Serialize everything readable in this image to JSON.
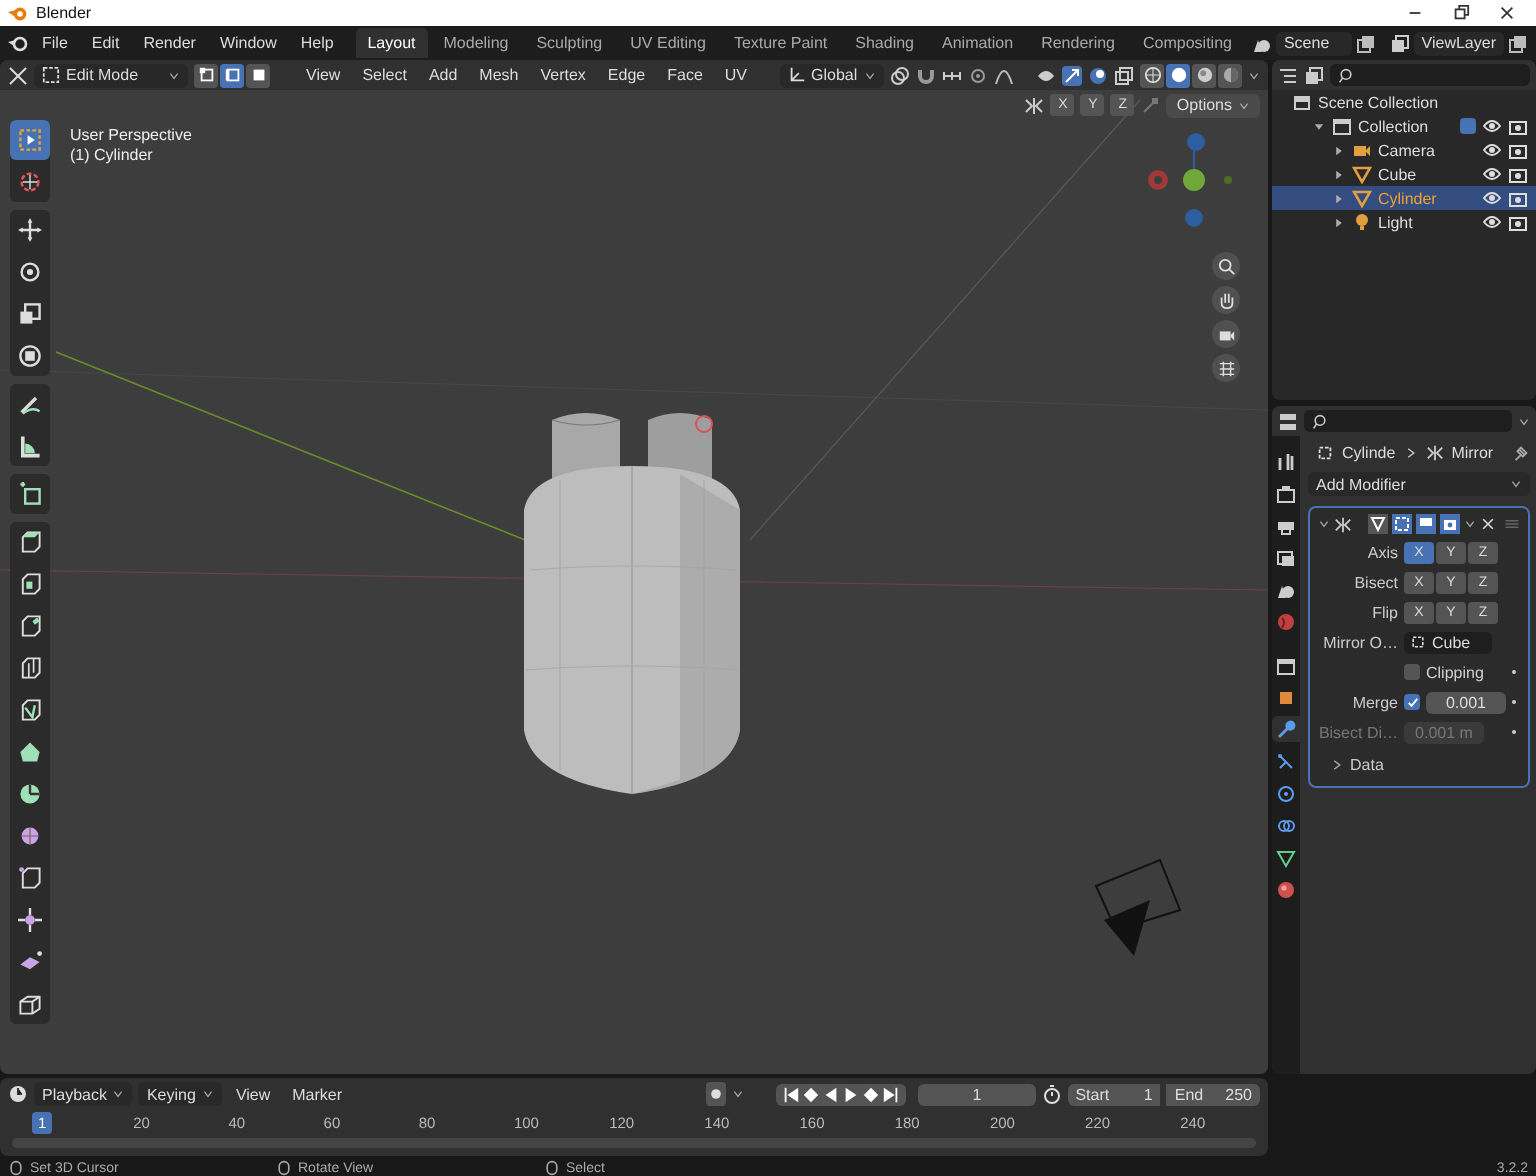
{
  "window": {
    "title": "Blender"
  },
  "menu": [
    "File",
    "Edit",
    "Render",
    "Window",
    "Help"
  ],
  "workspaces": [
    {
      "label": "Layout",
      "selected": true
    },
    {
      "label": "Modeling",
      "selected": false
    },
    {
      "label": "Sculpting",
      "selected": false
    },
    {
      "label": "UV Editing",
      "selected": false
    },
    {
      "label": "Texture Paint",
      "selected": false
    },
    {
      "label": "Shading",
      "selected": false
    },
    {
      "label": "Animation",
      "selected": false
    },
    {
      "label": "Rendering",
      "selected": false
    },
    {
      "label": "Compositing",
      "selected": false
    }
  ],
  "scene": "Scene",
  "view_layer": "ViewLayer",
  "viewport": {
    "mode": "Edit Mode",
    "select_modes": [
      {
        "selected": false
      },
      {
        "selected": true
      },
      {
        "selected": false
      }
    ],
    "menus": [
      "View",
      "Select",
      "Add",
      "Mesh",
      "Vertex",
      "Edge",
      "Face",
      "UV"
    ],
    "orientation": "Global",
    "shading_modes": [
      {
        "selected": false
      },
      {
        "selected": true
      },
      {
        "selected": false
      },
      {
        "selected": false
      }
    ],
    "mirror_axes": [
      "X",
      "Y",
      "Z"
    ],
    "options": "Options",
    "overlay": [
      "User Perspective",
      "(1) Cylinder"
    ],
    "tools": [
      [
        {
          "selected": true
        },
        {
          "selected": false
        }
      ],
      [
        {
          "selected": false
        },
        {
          "selected": false
        },
        {
          "selected": false
        },
        {
          "selected": false
        }
      ],
      [
        {
          "selected": false
        },
        {
          "selected": false
        }
      ],
      [
        {
          "selected": false
        }
      ],
      [
        {
          "selected": false
        },
        {
          "selected": false
        },
        {
          "selected": false
        },
        {
          "selected": false
        },
        {
          "selected": false
        },
        {
          "selected": false
        },
        {
          "selected": false
        },
        {
          "selected": false
        },
        {
          "selected": false
        },
        {
          "selected": false
        },
        {
          "selected": false
        },
        {
          "selected": false
        }
      ]
    ]
  },
  "outliner": {
    "root": "Scene Collection",
    "items": [
      {
        "name": "Collection",
        "kind": "collection",
        "expanded": true,
        "checked": true,
        "selected": false,
        "children": [
          {
            "name": "Camera",
            "kind": "camera",
            "selected": false
          },
          {
            "name": "Cube",
            "kind": "mesh",
            "selected": false
          },
          {
            "name": "Cylinder",
            "kind": "mesh",
            "selected": true
          },
          {
            "name": "Light",
            "kind": "light",
            "selected": false
          }
        ]
      }
    ]
  },
  "properties": {
    "tabs": [
      {
        "selected": false
      },
      {
        "selected": false
      },
      {
        "selected": false
      },
      {
        "selected": false
      },
      {
        "selected": false
      },
      {
        "selected": false
      },
      {
        "selected": false
      },
      {
        "selected": false
      },
      {
        "selected": true
      },
      {
        "selected": false
      },
      {
        "selected": false
      },
      {
        "selected": false
      },
      {
        "selected": false
      },
      {
        "selected": false
      }
    ],
    "breadcrumb": [
      "Cylinde",
      "Mirror"
    ],
    "add_modifier": "Add Modifier",
    "modifier": {
      "rows": [
        {
          "kind": "toggles",
          "label": "Axis",
          "options": [
            {
              "label": "X",
              "selected": true
            },
            {
              "label": "Y",
              "selected": false
            },
            {
              "label": "Z",
              "selected": false
            }
          ]
        },
        {
          "kind": "toggles",
          "label": "Bisect",
          "options": [
            {
              "label": "X",
              "selected": false
            },
            {
              "label": "Y",
              "selected": false
            },
            {
              "label": "Z",
              "selected": false
            }
          ]
        },
        {
          "kind": "toggles",
          "label": "Flip",
          "options": [
            {
              "label": "X",
              "selected": false
            },
            {
              "label": "Y",
              "selected": false
            },
            {
              "label": "Z",
              "selected": false
            }
          ]
        },
        {
          "kind": "object",
          "label": "Mirror O…",
          "value": "Cube"
        },
        {
          "kind": "checkbox",
          "label": "Clipping",
          "checked": false
        },
        {
          "kind": "checked_number",
          "label": "Merge",
          "checked": true,
          "value": "0.001"
        },
        {
          "kind": "number",
          "label": "Bisect Di…",
          "value": "0.001 m",
          "disabled": true
        }
      ],
      "subpanel": {
        "label": "Data",
        "expanded": false
      }
    }
  },
  "timeline": {
    "menus": [
      "Playback",
      "Keying",
      "View",
      "Marker"
    ],
    "current_frame": "1",
    "start_label": "Start",
    "start": "1",
    "end_label": "End",
    "end": "250",
    "ruler": [
      {
        "label": "1",
        "selected": true
      },
      {
        "label": "20",
        "selected": false
      },
      {
        "label": "40",
        "selected": false
      },
      {
        "label": "60",
        "selected": false
      },
      {
        "label": "80",
        "selected": false
      },
      {
        "label": "100",
        "selected": false
      },
      {
        "label": "120",
        "selected": false
      },
      {
        "label": "140",
        "selected": false
      },
      {
        "label": "160",
        "selected": false
      },
      {
        "label": "180",
        "selected": false
      },
      {
        "label": "200",
        "selected": false
      },
      {
        "label": "220",
        "selected": false
      },
      {
        "label": "240",
        "selected": false
      }
    ]
  },
  "status_bar": {
    "hints": [
      "Set 3D Cursor",
      "Rotate View",
      "Select"
    ],
    "version": "3.2.2"
  }
}
